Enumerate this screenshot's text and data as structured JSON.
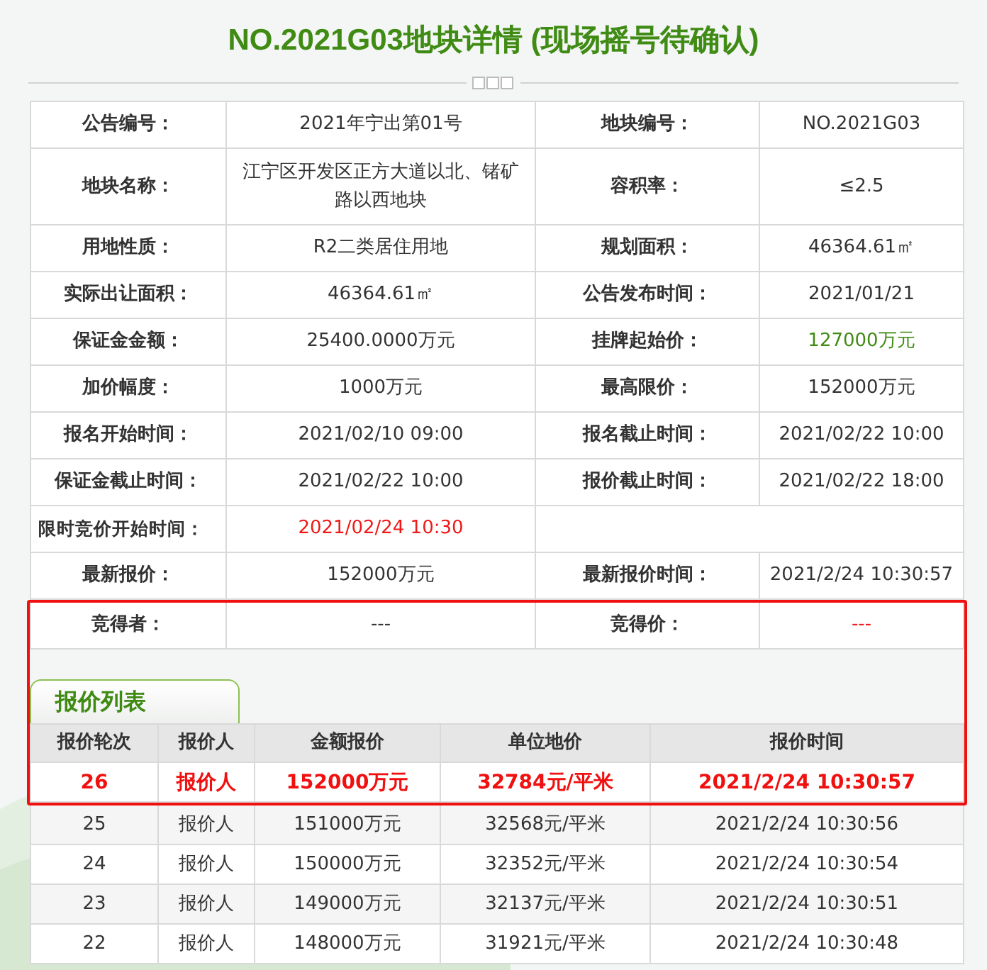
{
  "title": "NO.2021G03地块详情 (现场摇号待确认)",
  "info": {
    "rows": [
      {
        "cells": [
          {
            "kind": "label",
            "text": "公告编号："
          },
          {
            "kind": "value",
            "text": "2021年宁出第01号"
          },
          {
            "kind": "label",
            "text": "地块编号："
          },
          {
            "kind": "value",
            "text": "NO.2021G03"
          }
        ]
      },
      {
        "cells": [
          {
            "kind": "label",
            "text": "地块名称："
          },
          {
            "kind": "value",
            "text": "江宁区开发区正方大道以北、锗矿路以西地块"
          },
          {
            "kind": "label",
            "text": "容积率："
          },
          {
            "kind": "value",
            "text": "≤2.5"
          }
        ]
      },
      {
        "cells": [
          {
            "kind": "label",
            "text": "用地性质："
          },
          {
            "kind": "value",
            "text": "R2二类居住用地"
          },
          {
            "kind": "label",
            "text": "规划面积："
          },
          {
            "kind": "value",
            "text": "46364.61㎡"
          }
        ]
      },
      {
        "cells": [
          {
            "kind": "label",
            "text": "实际出让面积："
          },
          {
            "kind": "value",
            "text": "46364.61㎡"
          },
          {
            "kind": "label",
            "text": "公告发布时间："
          },
          {
            "kind": "value",
            "text": "2021/01/21"
          }
        ]
      },
      {
        "cells": [
          {
            "kind": "label",
            "text": "保证金金额："
          },
          {
            "kind": "value",
            "text": "25400.0000万元"
          },
          {
            "kind": "label",
            "text": "挂牌起始价："
          },
          {
            "kind": "accent",
            "text": "127000万元"
          }
        ]
      },
      {
        "cells": [
          {
            "kind": "label",
            "text": "加价幅度："
          },
          {
            "kind": "value",
            "text": "1000万元"
          },
          {
            "kind": "label",
            "text": "最高限价："
          },
          {
            "kind": "value",
            "text": "152000万元"
          }
        ]
      },
      {
        "cells": [
          {
            "kind": "label",
            "text": "报名开始时间："
          },
          {
            "kind": "value",
            "text": "2021/02/10 09:00"
          },
          {
            "kind": "label",
            "text": "报名截止时间："
          },
          {
            "kind": "value",
            "text": "2021/02/22 10:00"
          }
        ]
      },
      {
        "cells": [
          {
            "kind": "label",
            "text": "保证金截止时间："
          },
          {
            "kind": "value",
            "text": "2021/02/22 10:00"
          },
          {
            "kind": "label",
            "text": "报价截止时间："
          },
          {
            "kind": "value",
            "text": "2021/02/22 18:00"
          }
        ]
      },
      {
        "cells": [
          {
            "kind": "label",
            "text": "限时竞价开始时间："
          },
          {
            "kind": "alert",
            "text": "2021/02/24 10:30"
          }
        ]
      },
      {
        "cells": [
          {
            "kind": "label",
            "text": "最新报价："
          },
          {
            "kind": "value",
            "text": "152000万元"
          },
          {
            "kind": "label",
            "text": "最新报价时间："
          },
          {
            "kind": "value",
            "text": "2021/2/24 10:30:57"
          }
        ]
      }
    ]
  },
  "winner": {
    "cells": [
      {
        "kind": "label",
        "text": "竞得者："
      },
      {
        "kind": "value",
        "text": "---"
      },
      {
        "kind": "label",
        "text": "竞得价："
      },
      {
        "kind": "alert",
        "text": "---"
      }
    ]
  },
  "bids": {
    "tab": "报价列表",
    "columns": [
      "报价轮次",
      "报价人",
      "金额报价",
      "单位地价",
      "报价时间"
    ],
    "rows": [
      {
        "latest": true,
        "cells": [
          "26",
          "报价人",
          "152000万元",
          "32784元/平米",
          "2021/2/24 10:30:57"
        ]
      },
      {
        "latest": false,
        "cells": [
          "25",
          "报价人",
          "151000万元",
          "32568元/平米",
          "2021/2/24 10:30:56"
        ]
      },
      {
        "latest": false,
        "cells": [
          "24",
          "报价人",
          "150000万元",
          "32352元/平米",
          "2021/2/24 10:30:54"
        ]
      },
      {
        "latest": false,
        "cells": [
          "23",
          "报价人",
          "149000万元",
          "32137元/平米",
          "2021/2/24 10:30:51"
        ]
      },
      {
        "latest": false,
        "cells": [
          "22",
          "报价人",
          "148000万元",
          "31921元/平米",
          "2021/2/24 10:30:48"
        ]
      }
    ]
  }
}
